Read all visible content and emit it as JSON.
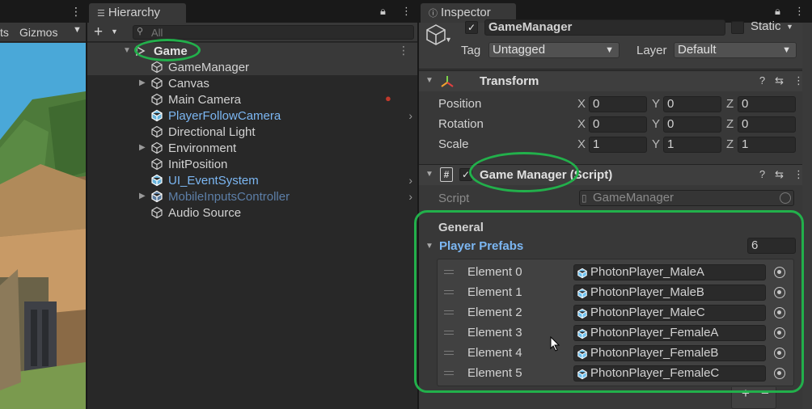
{
  "scene": {
    "toolbar_partial": "ts",
    "gizmos_label": "Gizmos"
  },
  "hierarchy": {
    "tab_label": "Hierarchy",
    "search_placeholder": "All",
    "root": "Game",
    "items": [
      {
        "label": "GameManager",
        "foldout": false,
        "style": "normal",
        "selected": true,
        "chevron": false
      },
      {
        "label": "Canvas",
        "foldout": true,
        "style": "normal",
        "selected": false,
        "chevron": false
      },
      {
        "label": "Main Camera",
        "foldout": false,
        "style": "normal",
        "selected": false,
        "chevron": false
      },
      {
        "label": "PlayerFollowCamera",
        "foldout": false,
        "style": "prefab",
        "selected": false,
        "chevron": true
      },
      {
        "label": "Directional Light",
        "foldout": false,
        "style": "normal",
        "selected": false,
        "chevron": false
      },
      {
        "label": "Environment",
        "foldout": true,
        "style": "normal",
        "selected": false,
        "chevron": false
      },
      {
        "label": "InitPosition",
        "foldout": false,
        "style": "normal",
        "selected": false,
        "chevron": false
      },
      {
        "label": "UI_EventSystem",
        "foldout": false,
        "style": "prefab",
        "selected": false,
        "chevron": true
      },
      {
        "label": "MobileInputsController",
        "foldout": true,
        "style": "prefab-dim",
        "selected": false,
        "chevron": true
      },
      {
        "label": "Audio Source",
        "foldout": false,
        "style": "normal",
        "selected": false,
        "chevron": false
      }
    ]
  },
  "inspector": {
    "tab_label": "Inspector",
    "object_name": "GameManager",
    "static_label": "Static",
    "tag_label": "Tag",
    "tag_value": "Untagged",
    "layer_label": "Layer",
    "layer_value": "Default",
    "transform": {
      "title": "Transform",
      "position_label": "Position",
      "rotation_label": "Rotation",
      "scale_label": "Scale",
      "x": "X",
      "y": "Y",
      "z": "Z",
      "position": [
        "0",
        "0",
        "0"
      ],
      "rotation": [
        "0",
        "0",
        "0"
      ],
      "scale": [
        "1",
        "1",
        "1"
      ]
    },
    "script_component": {
      "title": "Game Manager (Script)",
      "script_label": "Script",
      "script_value": "GameManager",
      "section": "General",
      "array_label": "Player Prefabs",
      "array_size": "6",
      "elements": [
        {
          "label": "Element 0",
          "value": "PhotonPlayer_MaleA"
        },
        {
          "label": "Element 1",
          "value": "PhotonPlayer_MaleB"
        },
        {
          "label": "Element 2",
          "value": "PhotonPlayer_MaleC"
        },
        {
          "label": "Element 3",
          "value": "PhotonPlayer_FemaleA"
        },
        {
          "label": "Element 4",
          "value": "PhotonPlayer_FemaleB"
        },
        {
          "label": "Element 5",
          "value": "PhotonPlayer_FemaleC"
        }
      ]
    }
  },
  "colors": {
    "annotation": "#22b04b",
    "prefab_blue": "#7cb7f3",
    "array_label_blue": "#7cb7f3"
  }
}
